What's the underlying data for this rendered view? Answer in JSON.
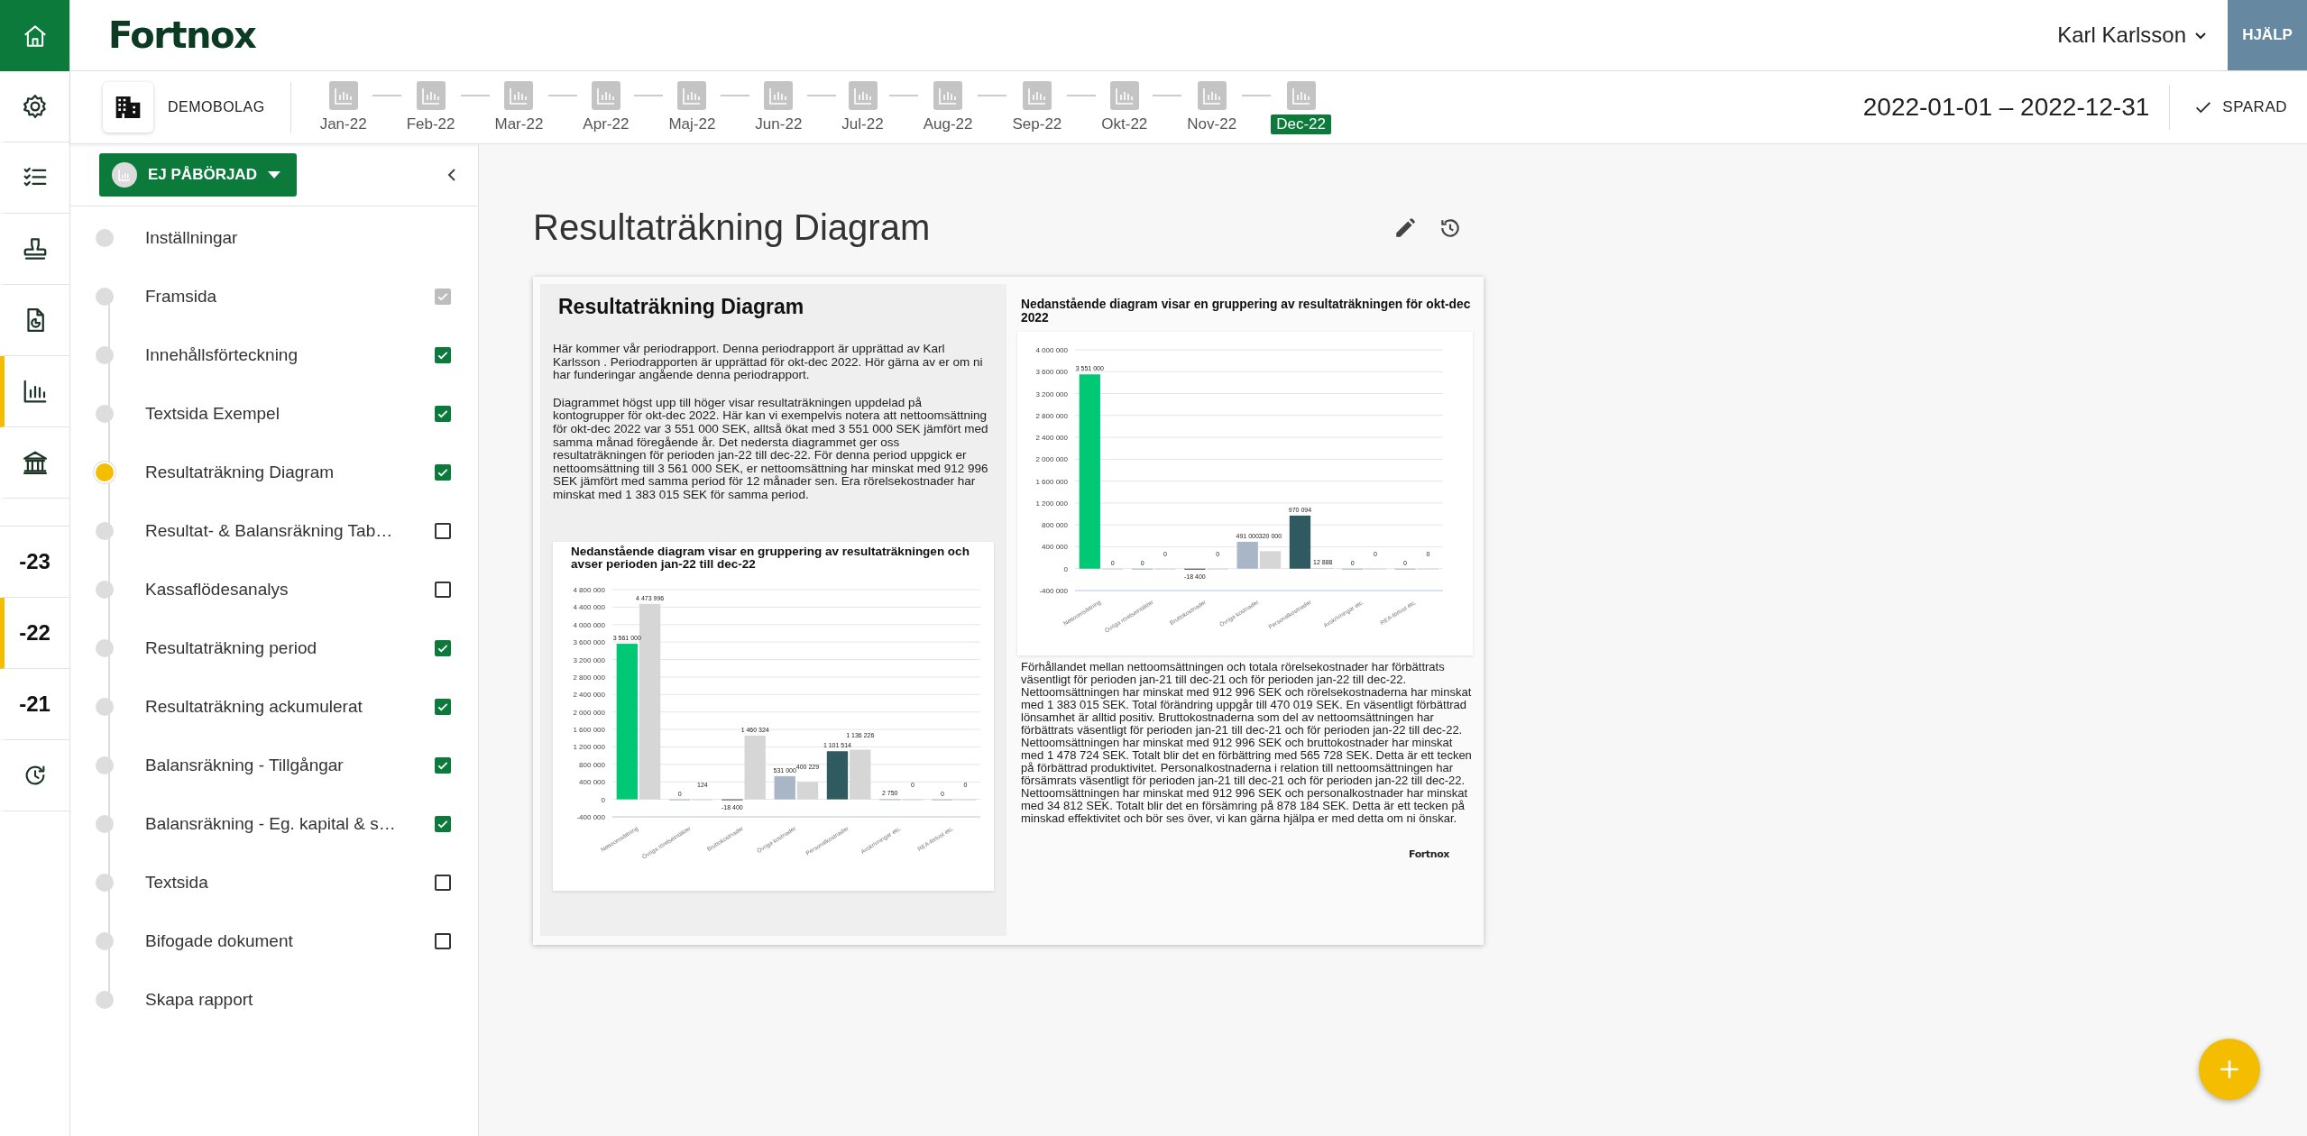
{
  "header": {
    "logo": "Fortnox",
    "user": "Karl Karlsson",
    "help": "HJÄLP"
  },
  "rail": {
    "tools": [
      {
        "selected": false
      },
      {
        "selected": false
      },
      {
        "selected": false
      },
      {
        "selected": false
      },
      {
        "selected": true
      },
      {
        "selected": false
      }
    ],
    "years": [
      {
        "label": "-23",
        "selected": false
      },
      {
        "label": "-22",
        "selected": true
      },
      {
        "label": "-21",
        "selected": false
      }
    ]
  },
  "subbar": {
    "company": "DEMOBOLAG",
    "period": "2022-01-01 – 2022-12-31",
    "saved": "SPARAD",
    "months": [
      {
        "label": "Jan-22",
        "selected": false
      },
      {
        "label": "Feb-22",
        "selected": false
      },
      {
        "label": "Mar-22",
        "selected": false
      },
      {
        "label": "Apr-22",
        "selected": false
      },
      {
        "label": "Maj-22",
        "selected": false
      },
      {
        "label": "Jun-22",
        "selected": false
      },
      {
        "label": "Jul-22",
        "selected": false
      },
      {
        "label": "Aug-22",
        "selected": false
      },
      {
        "label": "Sep-22",
        "selected": false
      },
      {
        "label": "Okt-22",
        "selected": false
      },
      {
        "label": "Nov-22",
        "selected": false
      },
      {
        "label": "Dec-22",
        "selected": true
      }
    ]
  },
  "sidebar": {
    "status": "EJ PÅBÖRJAD",
    "items": [
      {
        "label": "Inställningar",
        "kind": "plain",
        "selected": false
      },
      {
        "label": "Framsida",
        "kind": "check",
        "checked": true,
        "disabled": true,
        "selected": false
      },
      {
        "label": "Innehållsförteckning",
        "kind": "check",
        "checked": true,
        "disabled": false,
        "selected": false
      },
      {
        "label": "Textsida Exempel",
        "kind": "check",
        "checked": true,
        "disabled": false,
        "selected": false
      },
      {
        "label": "Resultaträkning Diagram",
        "kind": "check",
        "checked": true,
        "disabled": false,
        "selected": true
      },
      {
        "label": "Resultat- & Balansräkning Tab…",
        "kind": "check",
        "checked": false,
        "disabled": false,
        "selected": false
      },
      {
        "label": "Kassaflödesanalys",
        "kind": "check",
        "checked": false,
        "disabled": false,
        "selected": false
      },
      {
        "label": "Resultaträkning period",
        "kind": "check",
        "checked": true,
        "disabled": false,
        "selected": false
      },
      {
        "label": "Resultaträkning ackumulerat",
        "kind": "check",
        "checked": true,
        "disabled": false,
        "selected": false
      },
      {
        "label": "Balansräkning - Tillgångar",
        "kind": "check",
        "checked": true,
        "disabled": false,
        "selected": false
      },
      {
        "label": "Balansräkning - Eg. kapital & s…",
        "kind": "check",
        "checked": true,
        "disabled": false,
        "selected": false
      },
      {
        "label": "Textsida",
        "kind": "check",
        "checked": false,
        "disabled": false,
        "selected": false
      },
      {
        "label": "Bifogade dokument",
        "kind": "check",
        "checked": false,
        "disabled": false,
        "selected": false
      },
      {
        "label": "Skapa rapport",
        "kind": "plain",
        "selected": false
      }
    ]
  },
  "page": {
    "title": "Resultaträkning Diagram"
  },
  "document": {
    "heading": "Resultaträkning Diagram",
    "paragraphs": [
      "Här kommer vår periodrapport. Denna periodrapport är upprättad av Karl Karlsson . Periodrapporten är upprättad för okt-dec 2022. Hör gärna av er om ni har funderingar angående denna periodrapport.",
      "Diagrammet högst upp till höger visar resultaträkningen uppdelad på kontogrupper för okt-dec 2022. Här kan vi exempelvis notera att nettoomsättning för okt-dec 2022 var 3 551 000 SEK, alltså ökat med 3 551 000 SEK jämfört med samma månad föregående år. Det nedersta diagrammet ger oss resultaträkningen för perioden jan-22 till dec-22. För denna period uppgick er nettoomsättning till 3 561 000 SEK, er nettoomsättning har minskat med 912 996 SEK jämfört med samma period för 12 månader sen. Era rörelsekostnader har minskat med 1 383 015 SEK för samma period."
    ],
    "year_chart": {
      "chart_data": {
        "type": "bar",
        "grid": true,
        "title": "Nedanstående diagram visar en gruppering av resultaträkningen och avser perioden jan-22 till dec-22",
        "categories": [
          "Nettoomsättning",
          "Övriga rörelseintäkter",
          "Bruttokostnader",
          "Övriga kostnader",
          "Personalkostnader",
          "Avskrivningar etc.",
          "REA-förlust etc."
        ],
        "series": [
          {
            "colors": [
              "#00c875",
              "#a9b6c8",
              "#4a4a5a",
              "#a9b6c8",
              "#2f5a60",
              "#a9b6c8",
              "#a9b6c8"
            ],
            "values": [
              3561000,
              0,
              -18400,
              531000,
              1101514,
              2750,
              0
            ]
          },
          {
            "color": "#d6d6d6",
            "values": [
              4473996,
              124,
              1460324,
              400229,
              1136226,
              0,
              0
            ]
          }
        ],
        "ylim": [
          -400000,
          4800000
        ],
        "yticks": [
          {
            "value": -400000,
            "label": "-400 000"
          },
          {
            "value": 0,
            "label": "0"
          },
          {
            "value": 400000,
            "label": "400 000"
          },
          {
            "value": 800000,
            "label": "800 000"
          },
          {
            "value": 1200000,
            "label": "1 200 000"
          },
          {
            "value": 1600000,
            "label": "1 600 000"
          },
          {
            "value": 2000000,
            "label": "2 000 000"
          },
          {
            "value": 2400000,
            "label": "2 400 000"
          },
          {
            "value": 2800000,
            "label": "2 800 000"
          },
          {
            "value": 3200000,
            "label": "3 200 000"
          },
          {
            "value": 3600000,
            "label": "3 600 000"
          },
          {
            "value": 4000000,
            "label": "4 000 000"
          },
          {
            "value": 4400000,
            "label": "4 400 000"
          },
          {
            "value": 4800000,
            "label": "4 800 000"
          }
        ],
        "data_labels": true
      }
    },
    "quarter_chart": {
      "chart_data": {
        "type": "bar",
        "grid": true,
        "title": "Nedanstående diagram visar en gruppering av resultaträkningen för okt-dec 2022",
        "categories": [
          "Nettoomsättning",
          "Övriga rörelseintäkter",
          "Bruttokostnader",
          "Övriga kostnader",
          "Personalkostnader",
          "Avskrivningar etc.",
          "REA-förlust etc."
        ],
        "series": [
          {
            "colors": [
              "#00c875",
              "#a9b6c8",
              "#4a4a5a",
              "#a9b6c8",
              "#2f5a60",
              "#a9b6c8",
              "#a9b6c8"
            ],
            "values": [
              3551000,
              0,
              -18400,
              491000,
              970094,
              0,
              0
            ]
          },
          {
            "color": "#d6d6d6",
            "values": [
              0,
              0,
              0,
              320000,
              12888,
              0,
              0
            ]
          }
        ],
        "ylim": [
          -400000,
          4000000
        ],
        "yticks": [
          {
            "value": -400000,
            "label": "-400 000"
          },
          {
            "value": 0,
            "label": "0"
          },
          {
            "value": 400000,
            "label": "400 000"
          },
          {
            "value": 800000,
            "label": "800 000"
          },
          {
            "value": 1200000,
            "label": "1 200 000"
          },
          {
            "value": 1600000,
            "label": "1 600 000"
          },
          {
            "value": 2000000,
            "label": "2 000 000"
          },
          {
            "value": 2400000,
            "label": "2 400 000"
          },
          {
            "value": 2800000,
            "label": "2 800 000"
          },
          {
            "value": 3200000,
            "label": "3 200 000"
          },
          {
            "value": 3600000,
            "label": "3 600 000"
          },
          {
            "value": 4000000,
            "label": "4 000 000"
          }
        ],
        "data_labels": true
      }
    },
    "summary": "Förhållandet mellan nettoomsättningen och totala rörelsekostnader har förbättrats väsentligt för perioden jan-21 till dec-21 och för perioden jan-22 till dec-22. Nettoomsättningen har minskat med 912 996 SEK och rörelsekostnaderna har minskat med 1 383 015 SEK. Total förändring uppgår till 470 019 SEK. En väsentligt förbättrad lönsamhet är alltid positiv. Bruttokostnaderna som del av nettoomsättningen har förbättrats väsentligt för perioden jan-21 till dec-21 och för perioden jan-22 till dec-22. Nettoomsättningen har minskat med 912 996 SEK och bruttokostnader har minskat med 1 478 724 SEK. Totalt blir det en förbättring med 565 728 SEK. Detta är ett tecken på förbättrad produktivitet. Personalkostnaderna i relation till nettoomsättningen har försämrats väsentligt för perioden jan-21 till dec-21 och för perioden jan-22 till dec-22. Nettoomsättningen har minskat med 912 996 SEK och personalkostnader har minskat med 34 812 SEK. Totalt blir det en försämring på 878 184 SEK. Detta är ett tecken på minskad effektivitet och bör ses över, vi kan gärna hjälpa er med detta om ni önskar.",
    "footer_logo": "Fortnox"
  }
}
